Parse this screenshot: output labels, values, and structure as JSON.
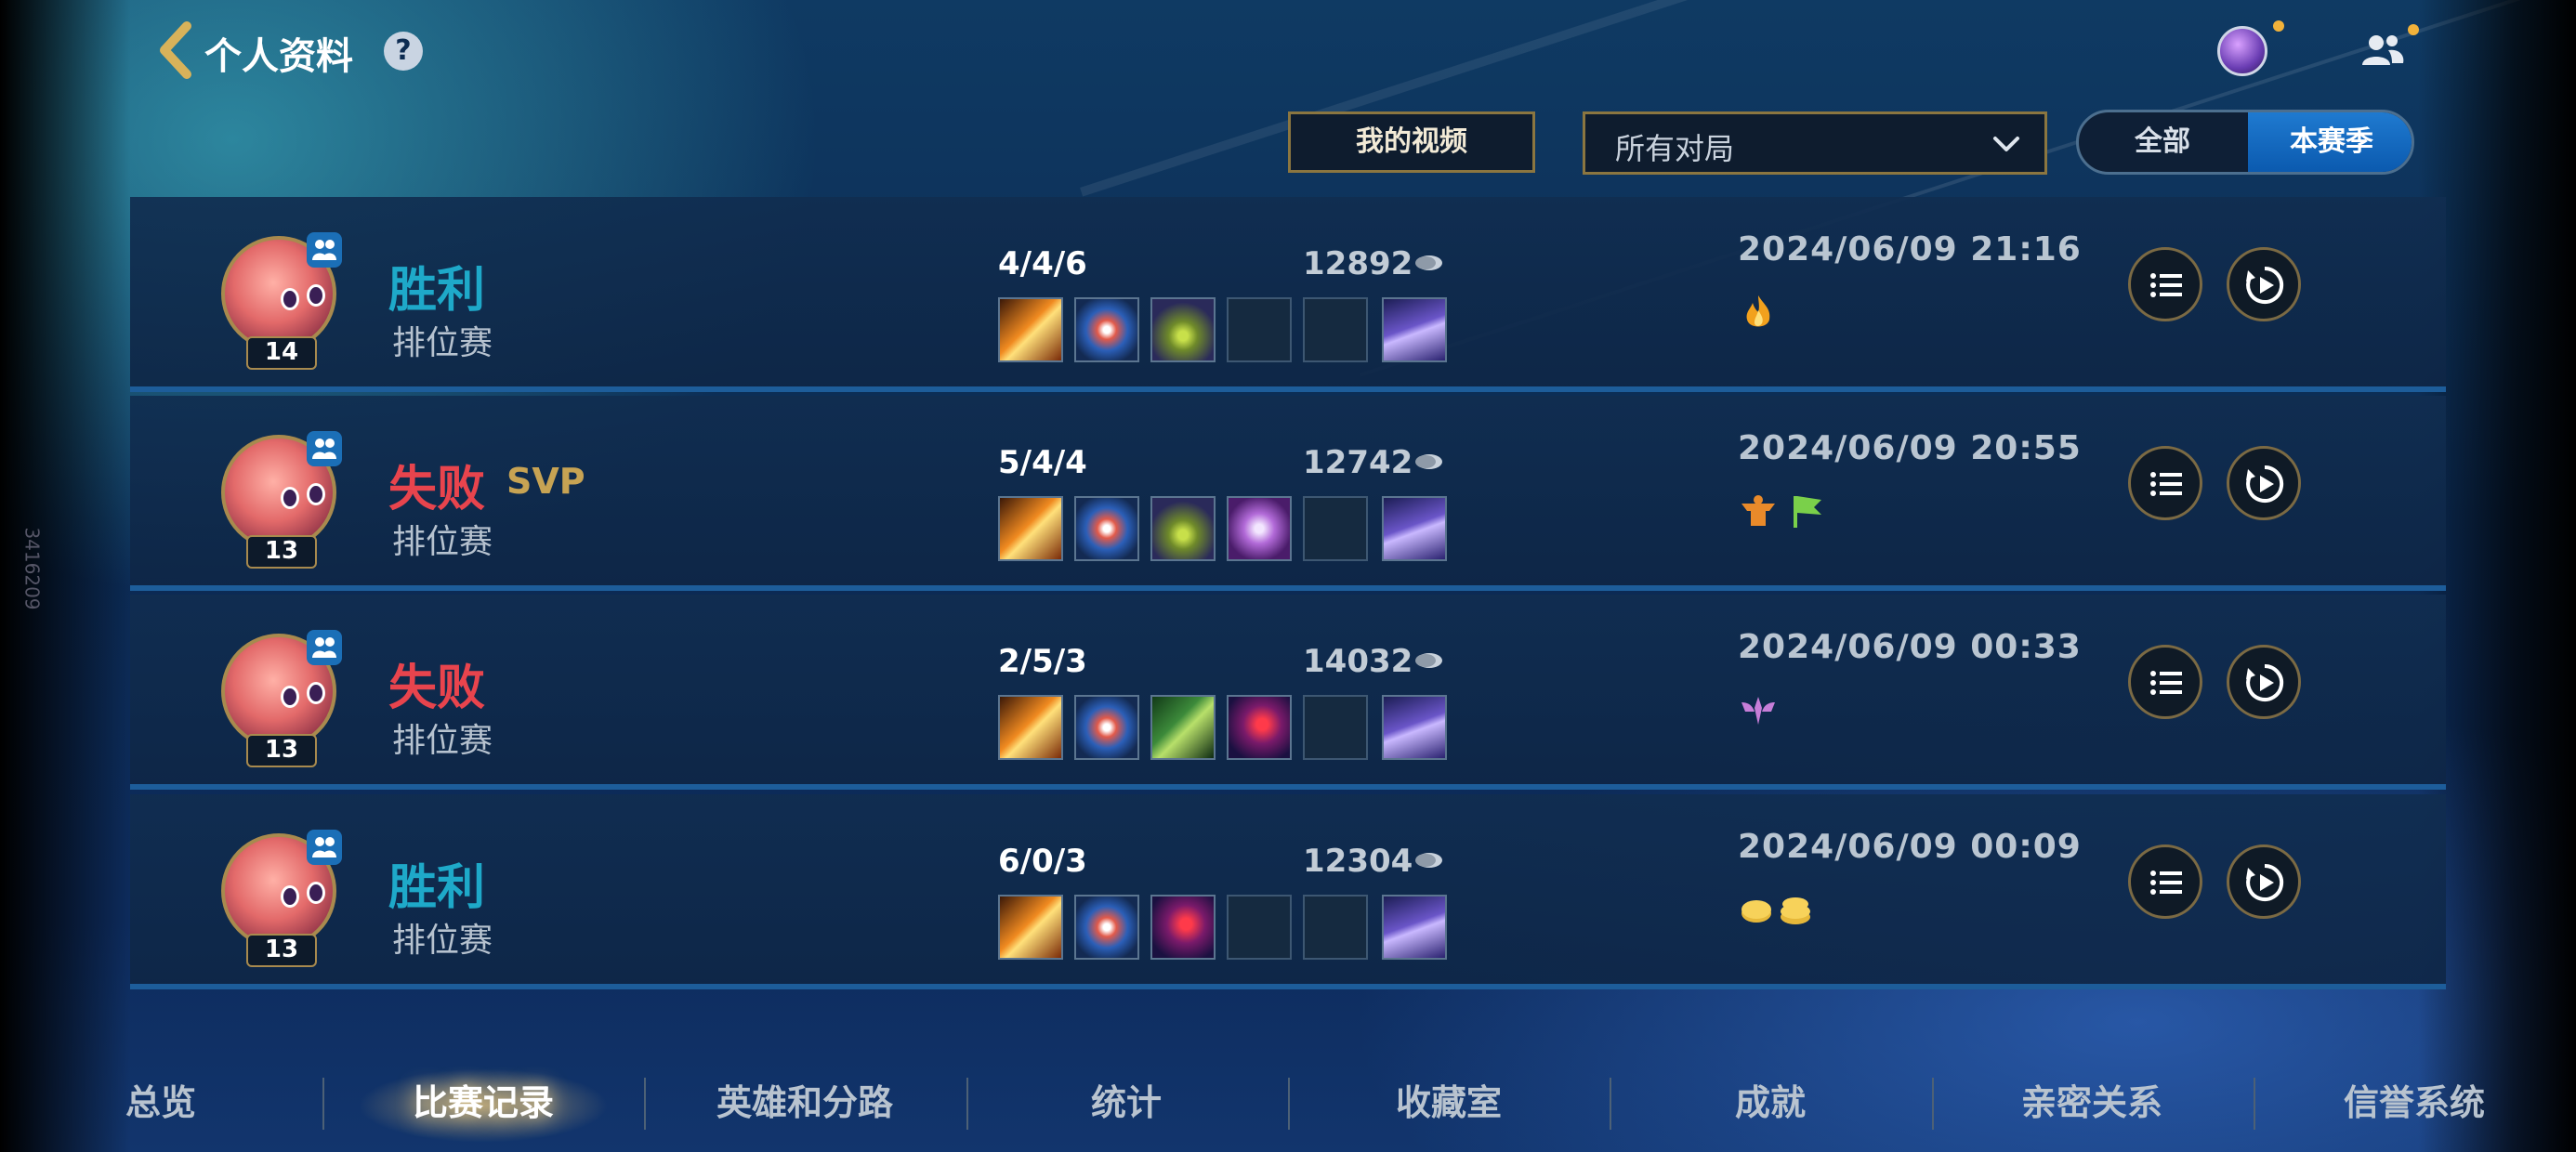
{
  "header": {
    "title": "个人资料",
    "help_label": "?"
  },
  "controls": {
    "videos_label": "我的视频",
    "match_filter": "所有对局",
    "season_all": "全部",
    "season_current": "本赛季"
  },
  "matches": [
    {
      "result": "胜利",
      "outcome": "win",
      "svp": "",
      "queue": "排位赛",
      "level": "14",
      "kda": "4/4/6",
      "gold": "12892",
      "time": "2024/06/09 21:16",
      "badges": [
        "fire-badge-icon"
      ]
    },
    {
      "result": "失败",
      "outcome": "loss",
      "svp": "SVP",
      "queue": "排位赛",
      "level": "13",
      "kda": "5/4/4",
      "gold": "12742",
      "time": "2024/06/09 20:55",
      "badges": [
        "turret-badge-icon",
        "flag-badge-icon"
      ]
    },
    {
      "result": "失败",
      "outcome": "loss",
      "svp": "",
      "queue": "排位赛",
      "level": "13",
      "kda": "2/5/3",
      "gold": "14032",
      "time": "2024/06/09 00:33",
      "badges": [
        "support-badge-icon"
      ]
    },
    {
      "result": "胜利",
      "outcome": "win",
      "svp": "",
      "queue": "排位赛",
      "level": "13",
      "kda": "6/0/3",
      "gold": "12304",
      "time": "2024/06/09 00:09",
      "badges": [
        "coins-badge-icon"
      ]
    }
  ],
  "tabs": [
    {
      "label": "总览"
    },
    {
      "label": "比赛记录",
      "active": true
    },
    {
      "label": "英雄和分路"
    },
    {
      "label": "统计"
    },
    {
      "label": "收藏室"
    },
    {
      "label": "成就"
    },
    {
      "label": "亲密关系"
    },
    {
      "label": "信誉系统"
    }
  ],
  "side_id": "3416209",
  "colors": {
    "win": "#1ea9c9",
    "loss": "#e8444d",
    "svp": "#c7a353",
    "accent_blue": "#1f7ad0",
    "gold_border": "#8b7640"
  }
}
